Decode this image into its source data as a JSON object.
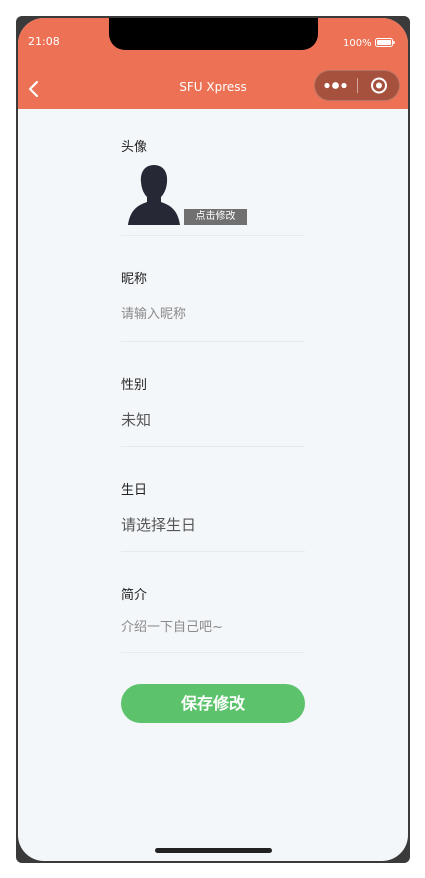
{
  "status_bar": {
    "time": "21:08",
    "battery": "100%"
  },
  "nav": {
    "title": "SFU Xpress"
  },
  "avatar": {
    "label": "头像",
    "edit_label": "点击修改"
  },
  "nickname": {
    "label": "昵称",
    "placeholder": "请输入昵称"
  },
  "gender": {
    "label": "性别",
    "value": "未知"
  },
  "birthday": {
    "label": "生日",
    "value": "请选择生日"
  },
  "bio": {
    "label": "简介",
    "placeholder": "介绍一下自己吧~"
  },
  "save_button": {
    "label": "保存修改"
  },
  "colors": {
    "header": "#ec7155",
    "save_button": "#5cc36c",
    "background": "#f4f7fa"
  }
}
